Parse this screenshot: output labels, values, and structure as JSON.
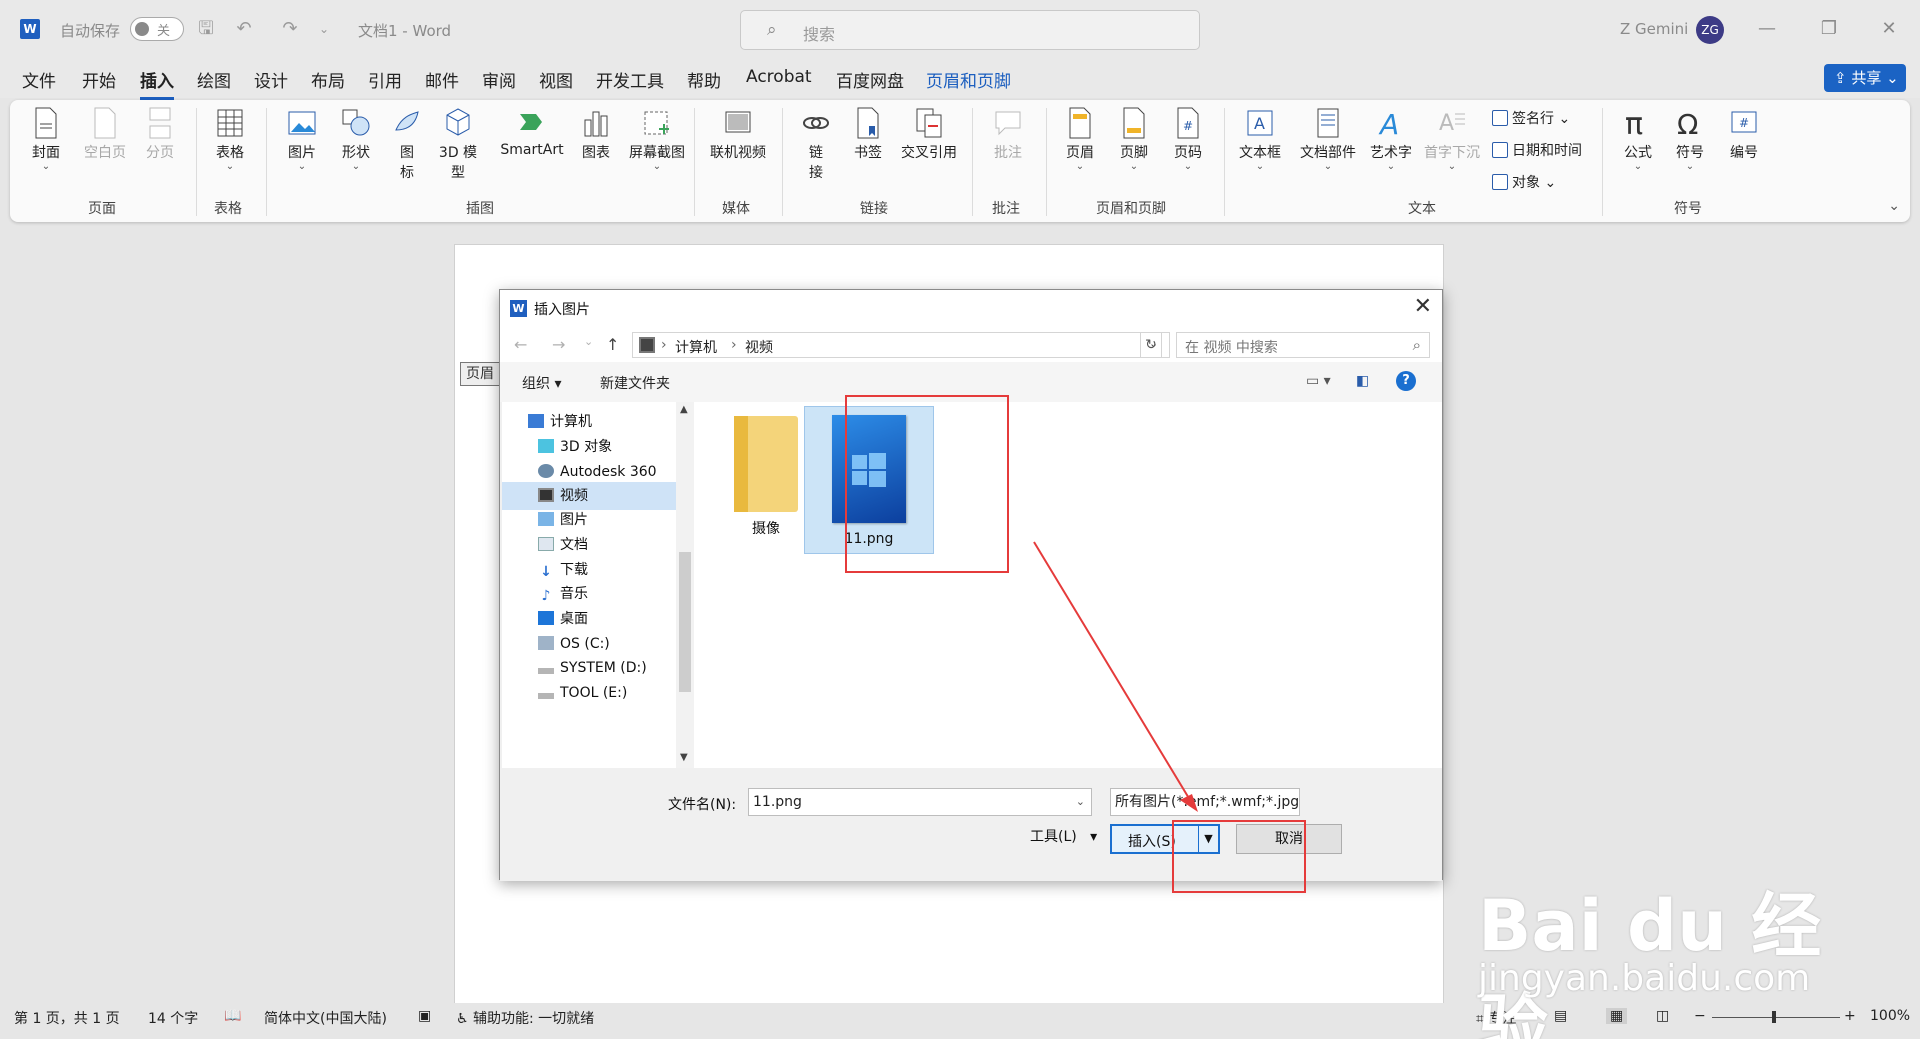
{
  "titlebar": {
    "autosave_label": "自动保存",
    "autosave_state": "关",
    "doc_title": "文档1  -  Word",
    "search_placeholder": "搜索",
    "user_name": "Z Gemini",
    "avatar_initials": "ZG"
  },
  "menu": {
    "tabs": [
      "文件",
      "开始",
      "插入",
      "绘图",
      "设计",
      "布局",
      "引用",
      "邮件",
      "审阅",
      "视图",
      "开发工具",
      "帮助",
      "Acrobat",
      "百度网盘",
      "页眉和页脚"
    ],
    "active": "插入",
    "share": "共享"
  },
  "ribbon": {
    "page_group": {
      "label": "页面",
      "cover": "封面",
      "blank": "空白页",
      "break": "分页"
    },
    "table_group": {
      "label": "表格",
      "table": "表格"
    },
    "illus_group": {
      "label": "插图",
      "picture": "图片",
      "shape": "形状",
      "icon1": "图",
      "icon2": "标",
      "model1": "3D 模",
      "model2": "型",
      "smartart": "SmartArt",
      "chart": "图表",
      "screenshot": "屏幕截图"
    },
    "media_group": {
      "label": "媒体",
      "video": "联机视频"
    },
    "link_group": {
      "label": "链接",
      "link1": "链",
      "link2": "接",
      "bookmark": "书签",
      "crossref": "交叉引用"
    },
    "comment_group": {
      "label": "批注",
      "comment": "批注"
    },
    "hf_group": {
      "label": "页眉和页脚",
      "header": "页眉",
      "footer": "页脚",
      "pagenum": "页码"
    },
    "text_group": {
      "label": "文本",
      "textbox": "文本框",
      "quickparts": "文档部件",
      "wordart": "艺术字",
      "dropcap": "首字下沉",
      "sigline": "签名行",
      "datetime": "日期和时间",
      "object": "对象"
    },
    "symbol_group": {
      "label": "符号",
      "equation": "公式",
      "symbol": "符号",
      "number": "编号"
    }
  },
  "document": {
    "header_tag": "页眉"
  },
  "dialog": {
    "title": "插入图片",
    "path": [
      "计算机",
      "视频"
    ],
    "search_placeholder": "在 视频 中搜索",
    "organize": "组织",
    "new_folder": "新建文件夹",
    "nav_items": [
      "计算机",
      "3D 对象",
      "Autodesk 360",
      "视频",
      "图片",
      "文档",
      "下载",
      "音乐",
      "桌面",
      "OS (C:)",
      "SYSTEM (D:)",
      "TOOL (E:)"
    ],
    "nav_selected": "视频",
    "files": {
      "folder": "摄像",
      "image": "11.png"
    },
    "filename_label": "文件名(N):",
    "filename_value": "11.png",
    "filetype": "所有图片(*.emf;*.wmf;*.jpg;*.j",
    "tools": "工具(L)",
    "insert": "插入(S)",
    "cancel": "取消"
  },
  "statusbar": {
    "page": "第 1 页，共 1 页",
    "words": "14 个字",
    "lang": "简体中文(中国大陆)",
    "access": "辅助功能: 一切就绪",
    "focus": "专注",
    "zoom": "100%"
  },
  "watermark": {
    "brand": "Bai du 经验",
    "url": "jingyan.baidu.com"
  },
  "colors": {
    "accent": "#1b5ebf",
    "annotation": "#e53b3b",
    "selection": "#cce4f7"
  }
}
